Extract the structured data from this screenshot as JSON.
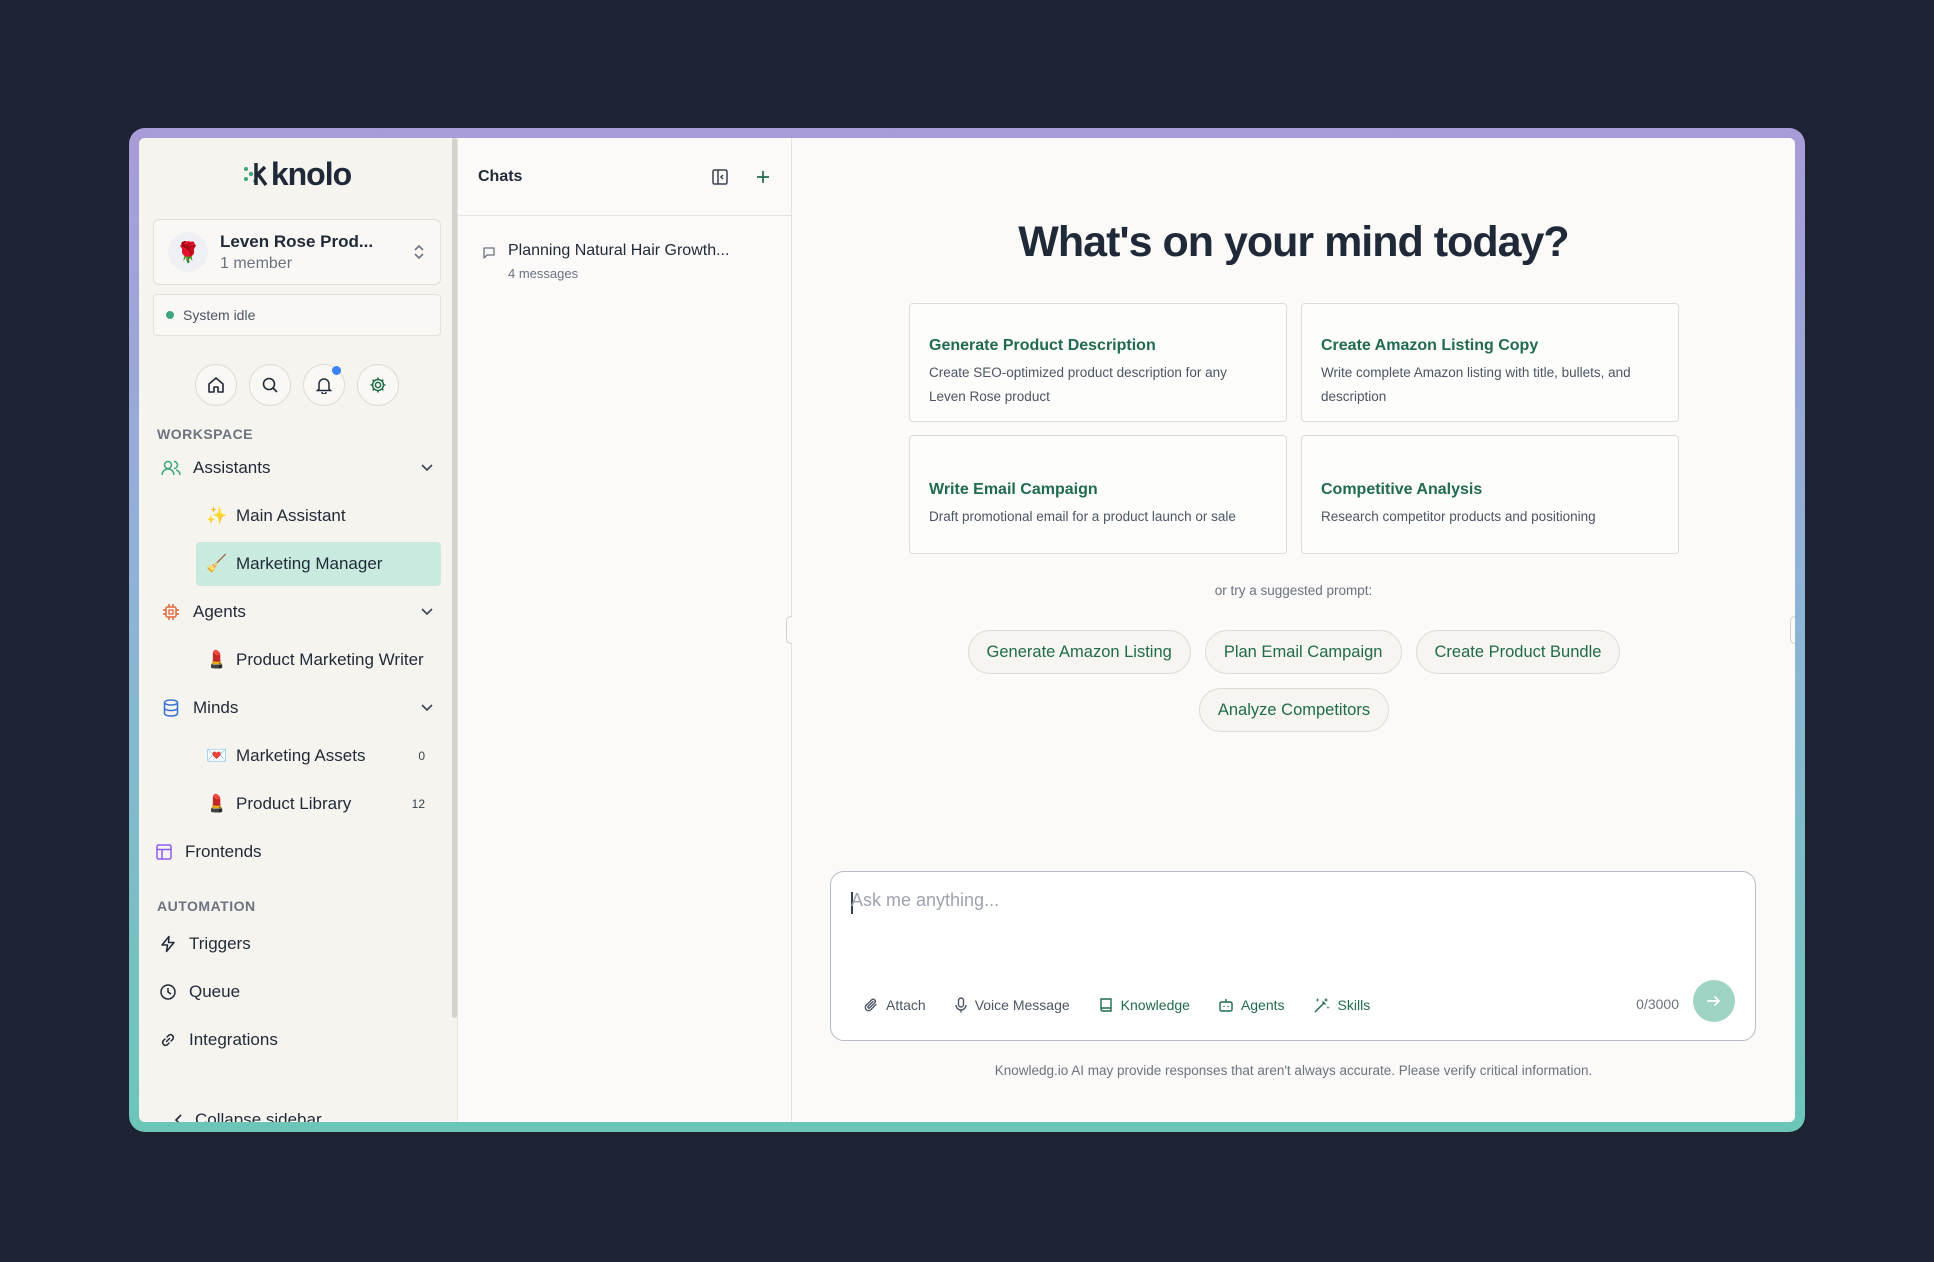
{
  "app": {
    "logo_text": "knolo"
  },
  "workspace": {
    "avatar_emoji": "🌹",
    "name": "Leven Rose Prod...",
    "members": "1 member"
  },
  "status": {
    "text": "System idle"
  },
  "sidebar": {
    "workspace_label": "WORKSPACE",
    "assistants_label": "Assistants",
    "assistants": [
      {
        "emoji": "✨",
        "label": "Main Assistant"
      },
      {
        "emoji": "🧹",
        "label": "Marketing Manager"
      }
    ],
    "agents_label": "Agents",
    "agents": [
      {
        "emoji": "💄",
        "label": "Product Marketing Writer"
      }
    ],
    "minds_label": "Minds",
    "minds": [
      {
        "emoji": "💌",
        "label": "Marketing Assets",
        "count": "0"
      },
      {
        "emoji": "💄",
        "label": "Product Library",
        "count": "12"
      }
    ],
    "frontends_label": "Frontends",
    "automation_label": "AUTOMATION",
    "automation": [
      {
        "label": "Triggers"
      },
      {
        "label": "Queue"
      },
      {
        "label": "Integrations"
      }
    ],
    "collapse_label": "Collapse sidebar"
  },
  "chats": {
    "title": "Chats",
    "items": [
      {
        "title": "Planning Natural Hair Growth...",
        "meta": "4 messages"
      }
    ]
  },
  "main": {
    "headline": "What's on your mind today?",
    "cards": [
      {
        "title": "Generate Product Description",
        "desc": "Create SEO-optimized product description for any Leven Rose product"
      },
      {
        "title": "Create Amazon Listing Copy",
        "desc": "Write complete Amazon listing with title, bullets, and description"
      },
      {
        "title": "Write Email Campaign",
        "desc": "Draft promotional email for a product launch or sale"
      },
      {
        "title": "Competitive Analysis",
        "desc": "Research competitor products and positioning"
      }
    ],
    "suggest_label": "or try a suggested prompt:",
    "pills": [
      "Generate Amazon Listing",
      "Plan Email Campaign",
      "Create Product Bundle",
      "Analyze Competitors"
    ],
    "composer": {
      "placeholder": "Ask me anything...",
      "tools": {
        "attach": "Attach",
        "voice": "Voice Message",
        "knowledge": "Knowledge",
        "agents": "Agents",
        "skills": "Skills"
      },
      "char_count": "0/3000"
    },
    "disclaimer": "Knowledg.io AI may provide responses that aren't always accurate. Please verify critical information."
  },
  "colors": {
    "accent": "#1f6b4b",
    "active_bg": "#c9ebdf",
    "background": "#1d2332"
  }
}
